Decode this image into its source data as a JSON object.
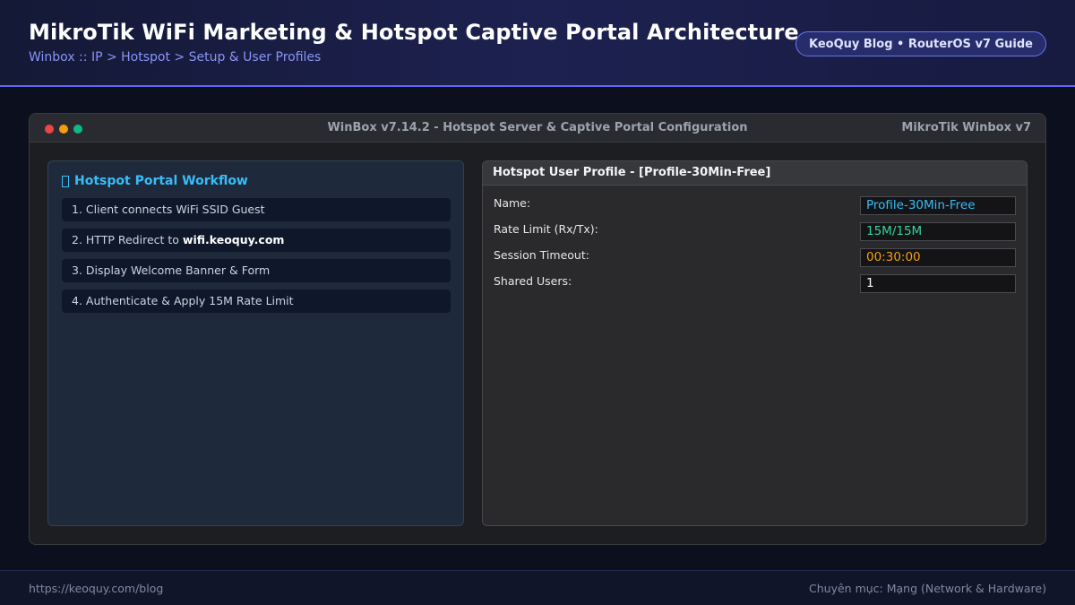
{
  "header": {
    "title": "MikroTik WiFi Marketing & Hotspot Captive Portal Architecture",
    "breadcrumb": "Winbox :: IP > Hotspot > Setup & User Profiles",
    "badge": "KeoQuy Blog • RouterOS v7 Guide"
  },
  "window": {
    "title": "WinBox v7.14.2 - Hotspot Server & Captive Portal Configuration",
    "brand": "MikroTik Winbox v7"
  },
  "workflow": {
    "icon": "box-icon",
    "heading": "Hotspot Portal Workflow",
    "steps": {
      "s1": "1. Client connects WiFi SSID Guest",
      "s2_prefix": "2. HTTP Redirect to ",
      "s2_domain": "wifi.keoquy.com",
      "s3": "3. Display Welcome Banner & Form",
      "s4": "4. Authenticate & Apply 15M Rate Limit"
    }
  },
  "profile": {
    "header": "Hotspot User Profile - [Profile-30Min-Free]",
    "fields": {
      "name": {
        "label": "Name:",
        "value": "Profile-30Min-Free",
        "color": "#38bdf8"
      },
      "rate_limit": {
        "label": "Rate Limit (Rx/Tx):",
        "value": "15M/15M",
        "color": "#34d399"
      },
      "session_timeout": {
        "label": "Session Timeout:",
        "value": "00:30:00",
        "color": "#f59e0b"
      },
      "shared_users": {
        "label": "Shared Users:",
        "value": "1",
        "color": "#ffffff"
      }
    }
  },
  "footer": {
    "url": "https://keoquy.com/blog",
    "category": "Chuyên mục: Mạng (Network & Hardware)"
  },
  "colors": {
    "accent": "#6366f1",
    "window_dots": [
      "#ef4444",
      "#f59e0b",
      "#10b981"
    ]
  }
}
